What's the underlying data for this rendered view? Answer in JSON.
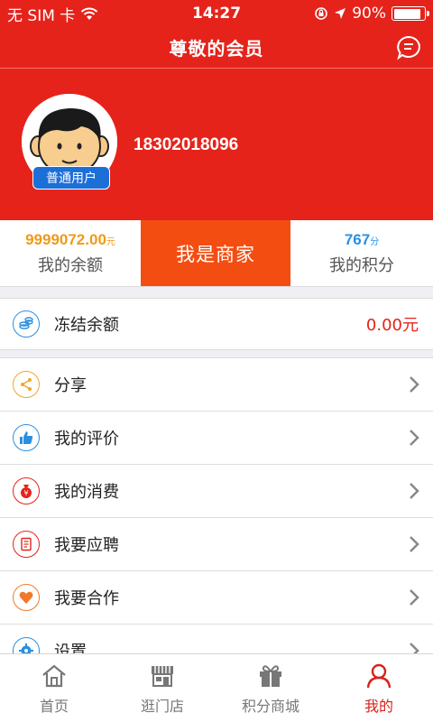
{
  "status_bar": {
    "carrier": "无 SIM 卡",
    "time": "14:27",
    "battery": "90%",
    "battery_level": 0.9
  },
  "header": {
    "title": "尊敬的会员"
  },
  "profile": {
    "badge": "普通用户",
    "phone": "18302018096"
  },
  "stats": {
    "balance_value": "9999072.00",
    "balance_unit": "元",
    "balance_label": "我的余额",
    "merchant_label": "我是商家",
    "points_value": "767",
    "points_unit": "分",
    "points_label": "我的积分"
  },
  "frozen": {
    "label": "冻结余额",
    "value": "0.00元"
  },
  "menu": [
    {
      "label": "分享",
      "icon": "share-icon",
      "color": "#f0a52a"
    },
    {
      "label": "我的评价",
      "icon": "thumbs-up-icon",
      "color": "#2a8fe0"
    },
    {
      "label": "我的消费",
      "icon": "money-bag-icon",
      "color": "#e5231b"
    },
    {
      "label": "我要应聘",
      "icon": "resume-icon",
      "color": "#e5231b"
    },
    {
      "label": "我要合作",
      "icon": "heart-icon",
      "color": "#f07a2a"
    },
    {
      "label": "设置",
      "icon": "gear-icon",
      "color": "#2a8fe0"
    }
  ],
  "tabs": [
    {
      "label": "首页",
      "icon": "home-icon"
    },
    {
      "label": "逛门店",
      "icon": "store-icon"
    },
    {
      "label": "积分商城",
      "icon": "gift-icon"
    },
    {
      "label": "我的",
      "icon": "user-icon"
    }
  ],
  "colors": {
    "brand_red": "#e5231b",
    "merchant_orange": "#f44d12",
    "balance_orange": "#f09a17",
    "points_blue": "#2a8fe0"
  }
}
